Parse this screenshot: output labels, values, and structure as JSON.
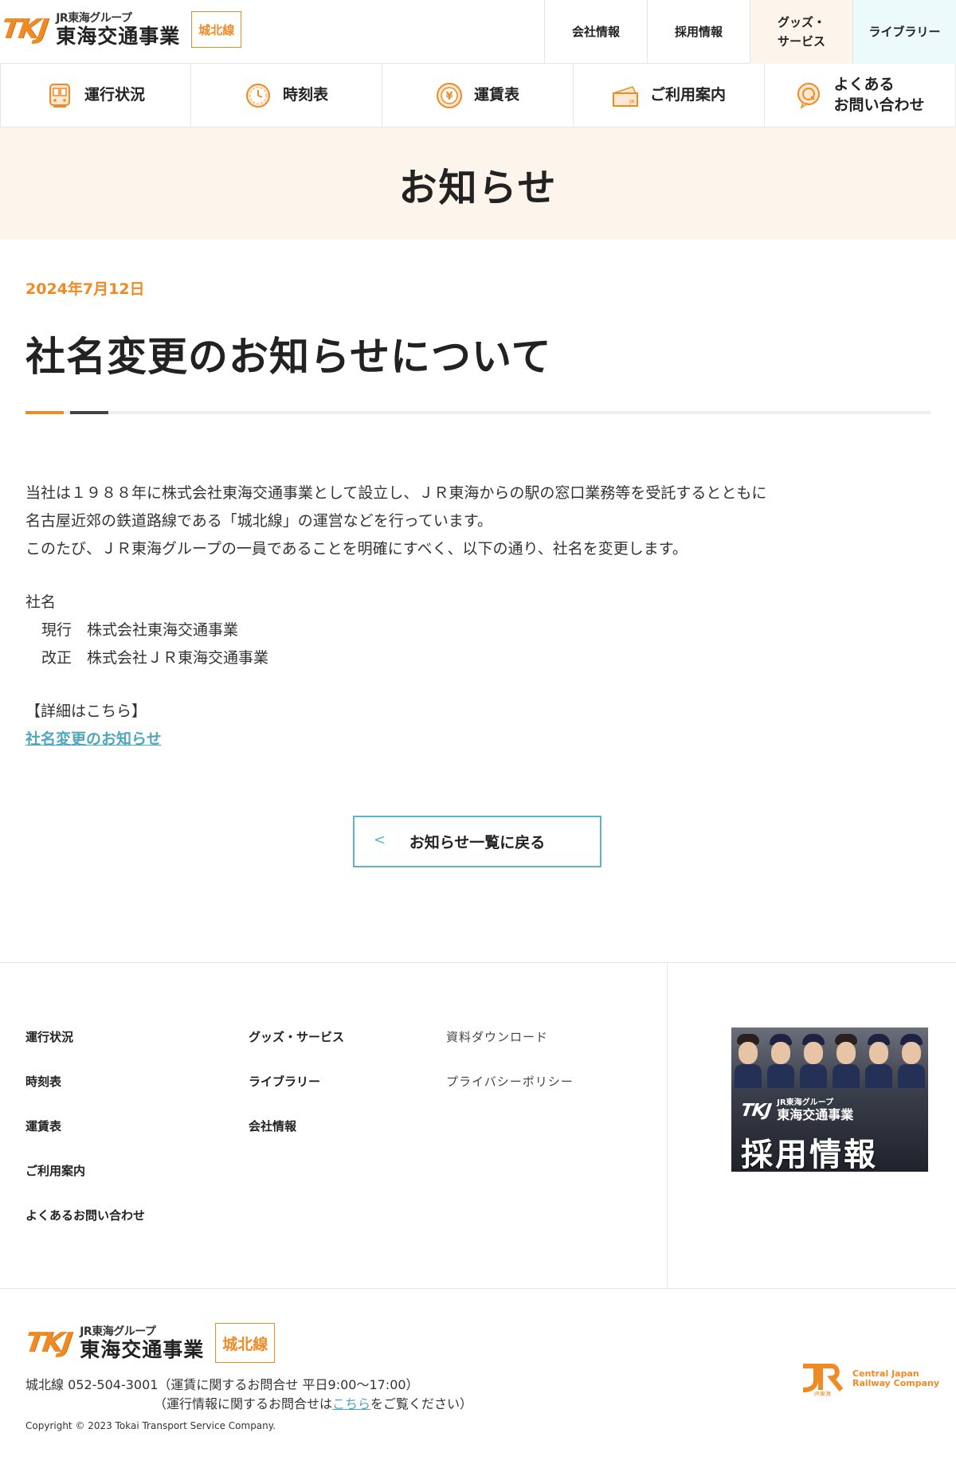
{
  "header": {
    "logo_mark": "TKJ",
    "logo_group": "JR東海グループ",
    "logo_name": "東海交通事業",
    "line_badge": "城北線",
    "top_links": [
      "会社情報",
      "採用情報",
      "グッズ・\nサービス",
      "ライブラリー"
    ]
  },
  "nav": {
    "items": [
      {
        "label": "運行状況",
        "icon": "train-icon"
      },
      {
        "label": "時刻表",
        "icon": "clock-icon"
      },
      {
        "label": "運賃表",
        "icon": "yen-icon"
      },
      {
        "label": "ご利用案内",
        "icon": "ticket-icon"
      },
      {
        "label": "よくある\nお問い合わせ",
        "icon": "question-icon"
      }
    ]
  },
  "page_title": "お知らせ",
  "article": {
    "date": "2024年7月12日",
    "title": "社名変更のお知らせについて",
    "paragraph1": [
      "当社は１９８８年に株式会社東海交通事業として設立し、ＪＲ東海からの駅の窓口業務等を受託するとともに",
      "名古屋近郊の鉄道路線である「城北線」の運営などを行っています。",
      "このたび、ＪＲ東海グループの一員であることを明確にすべく、以下の通り、社名を変更します。"
    ],
    "company_heading": "社名",
    "current_label": "現行",
    "current_name": "株式会社東海交通事業",
    "new_label": "改正",
    "new_name": "株式会社ＪＲ東海交通事業",
    "details_label": "【詳細はこちら】",
    "details_link": "社名変更のお知らせ"
  },
  "back_button": {
    "chevron": "<",
    "label": "お知らせ一覧に戻る"
  },
  "footer_nav": {
    "col1": [
      "運行状況",
      "時刻表",
      "運賃表",
      "ご利用案内",
      "よくあるお問い合わせ"
    ],
    "col2": [
      "グッズ・サービス",
      "ライブラリー",
      "会社情報"
    ],
    "col3": [
      "資料ダウンロード",
      "プライバシーポリシー"
    ],
    "recruit_banner": {
      "logo_mark": "TKJ",
      "group": "JR東海グループ",
      "name": "東海交通事業",
      "title": "採用情報"
    }
  },
  "footer": {
    "logo_mark": "TKJ",
    "logo_group": "JR東海グループ",
    "logo_name": "東海交通事業",
    "line_badge": "城北線",
    "contact_line1": "城北線 052-504-3001（運賃に関するお問合せ 平日9:00〜17:00）",
    "contact_line2_pre": "（運行情報に関するお問合せは",
    "contact_link": "こちら",
    "contact_line2_post": "をご覧ください）",
    "copyright": "Copyright © 2023 Tokai Transport Service Company.",
    "jr_line1": "Central Japan",
    "jr_line2": "Railway Company",
    "jr_sub": "JR東海"
  },
  "colors": {
    "accent_orange": "#f08a24",
    "accent_teal": "#5fb3c4",
    "title_band_bg": "#fdf5ec"
  }
}
